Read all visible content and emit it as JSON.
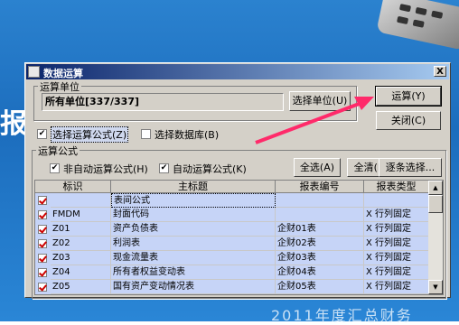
{
  "window": {
    "title": "数据运算",
    "close_label": "X"
  },
  "unit_group": {
    "label": "运算单位",
    "value": "所有单位[337/337]",
    "select_button": "选择单位(U)"
  },
  "buttons": {
    "compute": "运算(Y)",
    "close": "关闭(C)"
  },
  "options": {
    "select_formula": "选择运算公式(Z)",
    "select_database": "选择数据库(B)"
  },
  "formula_group": {
    "label": "运算公式",
    "non_auto": "非自动运算公式(H)",
    "auto": "自动运算公式(K)",
    "select_all": "全选(A)",
    "clear_all": "全清(L)",
    "select_each": "逐条选择..."
  },
  "table": {
    "headers": [
      "标识",
      "主标题",
      "报表编号",
      "报表类型"
    ],
    "rows": [
      {
        "id": "",
        "title": "表间公式",
        "code": "",
        "type": ""
      },
      {
        "id": "FMDM",
        "title": "封面代码",
        "code": "",
        "type": "X 行列固定"
      },
      {
        "id": "Z01",
        "title": "资产负债表",
        "code": "企财01表",
        "type": "X 行列固定"
      },
      {
        "id": "Z02",
        "title": "利润表",
        "code": "企财02表",
        "type": "X 行列固定"
      },
      {
        "id": "Z03",
        "title": "现金流量表",
        "code": "企财03表",
        "type": "X 行列固定"
      },
      {
        "id": "Z04",
        "title": "所有者权益变动表",
        "code": "企财04表",
        "type": "X 行列固定"
      },
      {
        "id": "Z05",
        "title": "国有资产变动情况表",
        "code": "企财05表",
        "type": "X 行列固定"
      }
    ]
  },
  "background": {
    "side_char": "报",
    "banner_text": "2011年度汇总财务"
  },
  "colors": {
    "title_start": "#0a246a",
    "title_end": "#a6caf0",
    "row_highlight": "#c6d4f7",
    "arrow": "#ff2a6a"
  }
}
